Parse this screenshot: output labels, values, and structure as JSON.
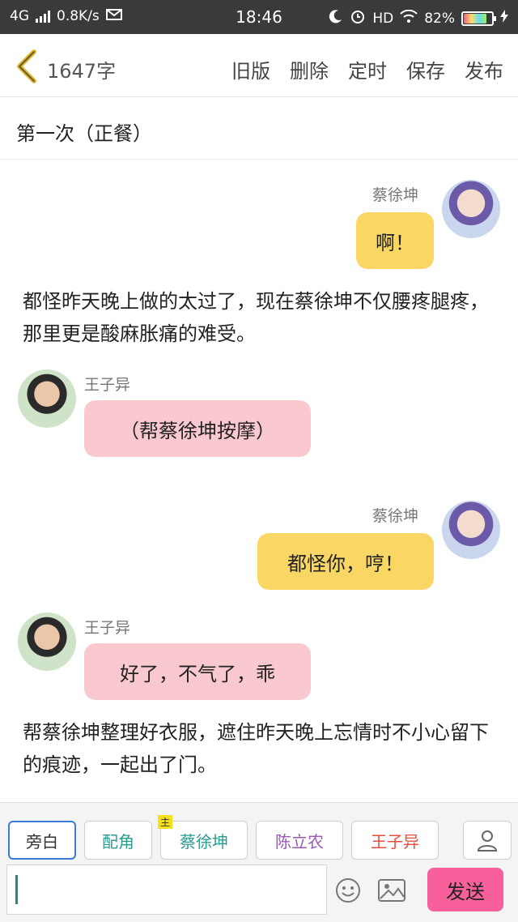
{
  "status_bar": {
    "network": "4G",
    "speed": "0.8K/s",
    "time": "18:46",
    "hd": "HD",
    "battery": "82%"
  },
  "header": {
    "word_count": "1647字",
    "actions": [
      "旧版",
      "删除",
      "定时",
      "保存",
      "发布"
    ]
  },
  "title": "第一次（正餐）",
  "messages": [
    {
      "speaker": "蔡徐坤",
      "text": "啊！"
    },
    {
      "narration": "都怪昨天晚上做的太过了，现在蔡徐坤不仅腰疼腿疼，那里更是酸麻胀痛的难受。"
    },
    {
      "speaker": "王子异",
      "text": "（帮蔡徐坤按摩）"
    },
    {
      "speaker": "蔡徐坤",
      "text": "都怪你，哼！"
    },
    {
      "speaker": "王子异",
      "text": "好了，不气了，乖"
    },
    {
      "narration": "帮蔡徐坤整理好衣服，遮住昨天晚上忘情时不小心留下的痕迹，一起出了门。"
    }
  ],
  "roles": {
    "narrator": "旁白",
    "supporting": "配角",
    "main_tag": "主",
    "main": "蔡徐坤",
    "role_3": "陈立农",
    "role_4": "王子异"
  },
  "send_label": "发送",
  "colors": {
    "yellow_bubble": "#fad765",
    "pink_bubble": "#fac9d0",
    "send_button": "#f7609a"
  }
}
